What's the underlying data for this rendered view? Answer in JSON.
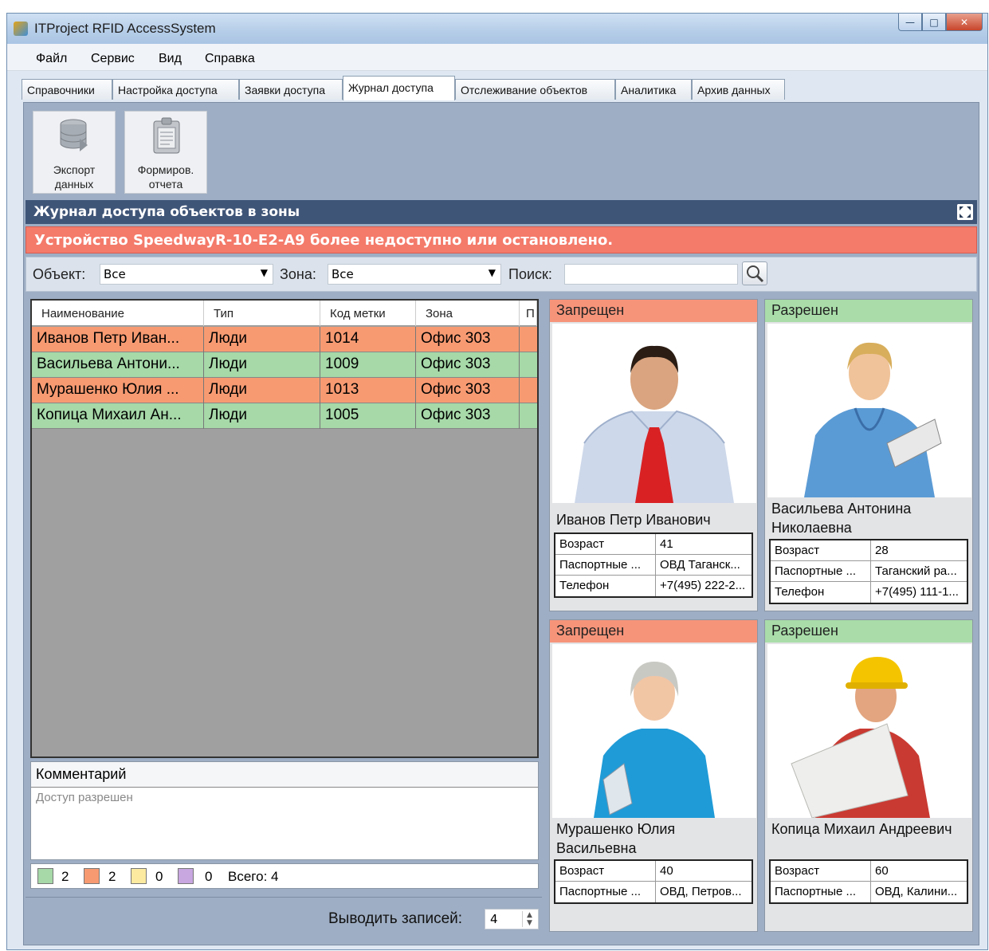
{
  "window": {
    "title": "ITProject RFID AccessSystem",
    "buttons": [
      "minimize",
      "maximize",
      "close"
    ]
  },
  "menu": [
    "Файл",
    "Сервис",
    "Вид",
    "Справка"
  ],
  "tabs": [
    {
      "label": "Справочники",
      "active": false
    },
    {
      "label": "Настройка доступа",
      "active": false
    },
    {
      "label": "Заявки доступа",
      "active": false
    },
    {
      "label": "Журнал доступа",
      "active": true
    },
    {
      "label": "Отслеживание объектов",
      "active": false
    },
    {
      "label": "Аналитика",
      "active": false
    },
    {
      "label": "Архив данных",
      "active": false
    }
  ],
  "toolbar": {
    "export": {
      "line1": "Экспорт",
      "line2": "данных",
      "icon": "database-export-icon"
    },
    "report": {
      "line1": "Формиров.",
      "line2": "отчета",
      "icon": "clipboard-report-icon"
    }
  },
  "section_title": "Журнал доступа объектов в зоны",
  "alert": "Устройство SpeedwayR-10-E2-A9 более недоступно или остановлено.",
  "filters": {
    "object_label": "Объект:",
    "object_value": "Все",
    "zone_label": "Зона:",
    "zone_value": "Все",
    "search_label": "Поиск:",
    "search_value": ""
  },
  "table": {
    "columns": [
      "Наименование",
      "Тип",
      "Код метки",
      "Зона",
      "П"
    ],
    "rows": [
      {
        "name": "Иванов Петр Иван...",
        "type": "Люди",
        "code": "1014",
        "zone": "Офис 303",
        "status": "deny"
      },
      {
        "name": "Васильева Антони...",
        "type": "Люди",
        "code": "1009",
        "zone": "Офис 303",
        "status": "allow"
      },
      {
        "name": "Мурашенко Юлия ...",
        "type": "Люди",
        "code": "1013",
        "zone": "Офис 303",
        "status": "deny"
      },
      {
        "name": "Копица Михаил Ан...",
        "type": "Люди",
        "code": "1005",
        "zone": "Офис 303",
        "status": "allow"
      }
    ]
  },
  "comment": {
    "title": "Комментарий",
    "text": "Доступ разрешен"
  },
  "legend": {
    "green": "2",
    "orange": "2",
    "yellow": "0",
    "purple": "0",
    "total": "Всего: 4",
    "colors": {
      "green": "#a6d8a8",
      "orange": "#f79a72",
      "yellow": "#fbeaa0",
      "purple": "#c8a6e0"
    }
  },
  "records": {
    "label": "Выводить записей:",
    "value": "4"
  },
  "cards": [
    {
      "status": "Запрещен",
      "kind": "deny",
      "name": "Иванов Петр Иванович",
      "props": [
        [
          "Возраст",
          "41"
        ],
        [
          "Паспортные ...",
          "ОВД Таганск..."
        ],
        [
          "Телефон",
          "+7(495) 222-2..."
        ]
      ]
    },
    {
      "status": "Разрешен",
      "kind": "allow",
      "name": "Васильева Антонина Николаевна",
      "props": [
        [
          "Возраст",
          "28"
        ],
        [
          "Паспортные ...",
          "Таганский ра..."
        ],
        [
          "Телефон",
          "+7(495) 111-1..."
        ]
      ]
    },
    {
      "status": "Запрещен",
      "kind": "deny",
      "name": "Мурашенко Юлия Васильевна",
      "props": [
        [
          "Возраст",
          "40"
        ],
        [
          "Паспортные ...",
          "ОВД, Петров..."
        ]
      ]
    },
    {
      "status": "Разрешен",
      "kind": "allow",
      "name": "Копица Михаил Андреевич",
      "props": [
        [
          "Возраст",
          "60"
        ],
        [
          "Паспортные ...",
          "ОВД, Калини..."
        ]
      ]
    }
  ]
}
